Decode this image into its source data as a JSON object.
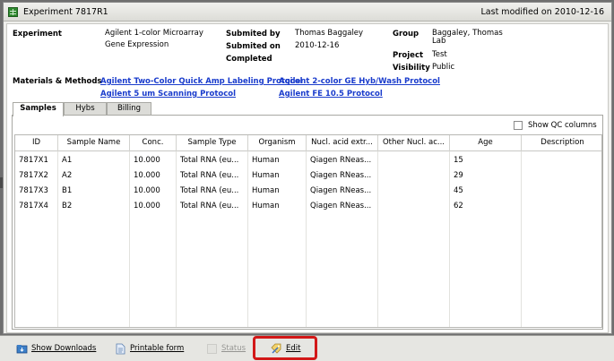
{
  "window": {
    "title": "Experiment 7817R1",
    "last_modified": "Last modified on 2010-12-16"
  },
  "details": {
    "experiment_label": "Experiment",
    "experiment_line1": "Agilent 1-color Microarray",
    "experiment_line2": "Gene Expression",
    "submitted_by_label": "Submited by",
    "submitted_by": "Thomas Baggaley",
    "submitted_on_label": "Submited on",
    "submitted_on": "2010-12-16",
    "completed_label": "Completed",
    "group_label": "Group",
    "group_line1": "Baggaley, Thomas",
    "group_line2": "Lab",
    "project_label": "Project",
    "project": "Test",
    "visibility_label": "Visibility",
    "visibility": "Public",
    "materials_label": "Materials & Methods",
    "protocols": [
      "Agilent Two-Color Quick Amp Labeling Protocol",
      "Agilent 2-color GE Hyb/Wash Protocol",
      "Agilent 5 um Scanning Protocol",
      "Agilent FE 10.5 Protocol"
    ]
  },
  "tabs": [
    "Samples",
    "Hybs",
    "Billing"
  ],
  "show_qc_label": "Show QC columns",
  "table": {
    "columns": [
      "ID",
      "Sample Name",
      "Conc.",
      "Sample Type",
      "Organism",
      "Nucl. acid extr...",
      "Other Nucl. ac...",
      "Age",
      "Description"
    ],
    "rows": [
      [
        "7817X1",
        "A1",
        "10.000",
        "Total RNA (eu...",
        "Human",
        "Qiagen RNeas...",
        "",
        "15",
        ""
      ],
      [
        "7817X2",
        "A2",
        "10.000",
        "Total RNA (eu...",
        "Human",
        "Qiagen RNeas...",
        "",
        "29",
        ""
      ],
      [
        "7817X3",
        "B1",
        "10.000",
        "Total RNA (eu...",
        "Human",
        "Qiagen RNeas...",
        "",
        "45",
        ""
      ],
      [
        "7817X4",
        "B2",
        "10.000",
        "Total RNA (eu...",
        "Human",
        "Qiagen RNeas...",
        "",
        "62",
        ""
      ]
    ]
  },
  "bottom": {
    "show_downloads": "Show Downloads",
    "printable_form": "Printable form",
    "disabled_label": "Status",
    "edit": "Edit"
  },
  "colors": {
    "link": "#1a3ccc",
    "highlight": "#d21818",
    "title_icon": "#2f8a2f"
  }
}
